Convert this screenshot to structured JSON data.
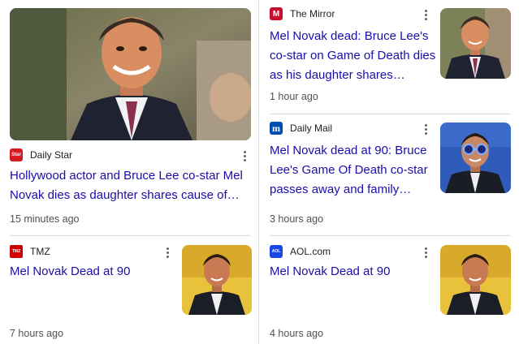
{
  "articles": [
    {
      "source": "Daily Star",
      "logo_text": "Star",
      "logo_color": "#d71920",
      "headline": "Hollywood actor and Bruce Lee co-star Mel Novak dies as daughter shares cause of…",
      "time": "15 minutes ago",
      "image": "man-smiling-suit-photo"
    },
    {
      "source": "The Mirror",
      "logo_text": "M",
      "logo_color": "#c8102e",
      "headline": "Mel Novak dead: Bruce Lee's co-star on Game of Death dies as his daughter shares…",
      "time": "1 hour ago",
      "image": "man-smiling-suit-photo"
    },
    {
      "source": "Daily Mail",
      "logo_text": "m",
      "logo_color": "#004db3",
      "headline": "Mel Novak dead at 90: Bruce Lee's Game Of Death co-star passes away and family…",
      "time": "3 hours ago",
      "image": "man-blue-sunglasses-photo"
    },
    {
      "source": "TMZ",
      "logo_text": "TMZ",
      "logo_color": "#cc0000",
      "headline": "Mel Novak Dead at 90",
      "time": "7 hours ago",
      "image": "man-portrait-photo"
    },
    {
      "source": "AOL.com",
      "logo_text": "AOL",
      "logo_color": "#1a47e5",
      "headline": "Mel Novak Dead at 90",
      "time": "4 hours ago",
      "image": "man-portrait-photo"
    }
  ],
  "colors": {
    "headline": "#1a0dab",
    "meta": "#4d5156",
    "divider": "#dadce0"
  },
  "icons": {
    "more": "more-vert-icon"
  }
}
